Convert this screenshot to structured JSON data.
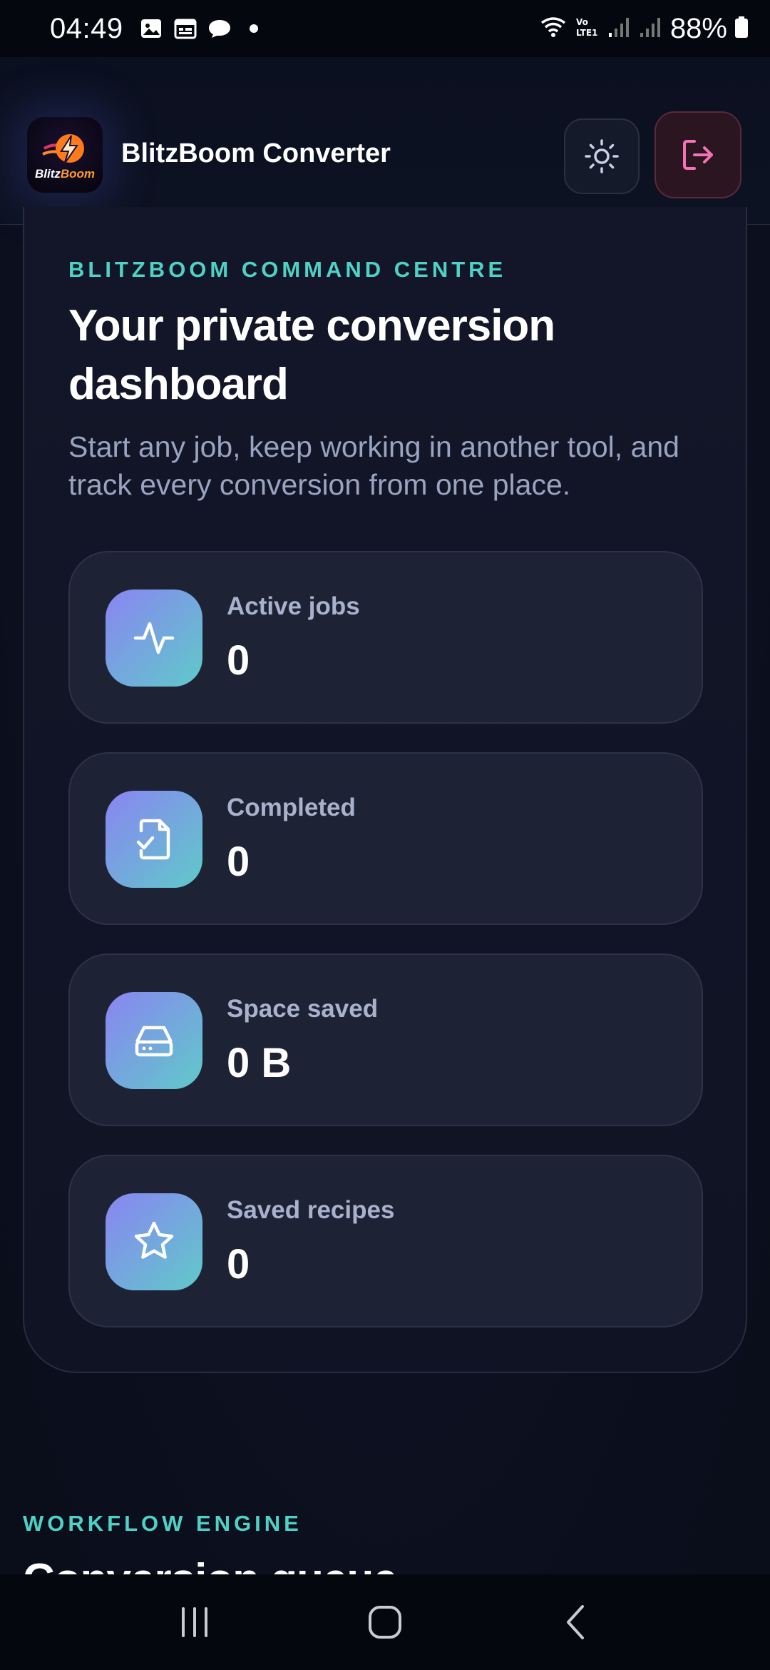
{
  "status_bar": {
    "time": "04:49",
    "battery": "88%",
    "icons": [
      "image-icon",
      "calendar-icon",
      "chat-icon",
      "dot-icon",
      "wifi-icon",
      "volte-icon",
      "signal-icon",
      "signal-icon",
      "battery-icon"
    ]
  },
  "header": {
    "logo_text_primary": "Blitz",
    "logo_text_accent": "Boom",
    "title": "BlitzBoom Converter",
    "theme_button": "sun-icon",
    "logout_button": "logout-icon"
  },
  "hero": {
    "eyebrow": "BLITZBOOM COMMAND CENTRE",
    "title": "Your private conversion dashboard",
    "subtitle": "Start any job, keep working in another tool, and track every conversion from one place."
  },
  "stats": [
    {
      "label": "Active jobs",
      "value": "0",
      "icon": "activity-icon"
    },
    {
      "label": "Completed",
      "value": "0",
      "icon": "file-check-icon"
    },
    {
      "label": "Space saved",
      "value": "0 B",
      "icon": "hard-drive-icon"
    },
    {
      "label": "Saved recipes",
      "value": "0",
      "icon": "star-icon"
    }
  ],
  "next_section": {
    "eyebrow": "WORKFLOW ENGINE",
    "title": "Conversion queue"
  },
  "nav": {
    "recents": "recents-icon",
    "home": "home-icon",
    "back": "back-icon"
  },
  "colors": {
    "accent_teal": "#4fd1c5",
    "gradient_start": "#8a84f2",
    "gradient_end": "#5fcac9",
    "danger": "#f472b6"
  }
}
